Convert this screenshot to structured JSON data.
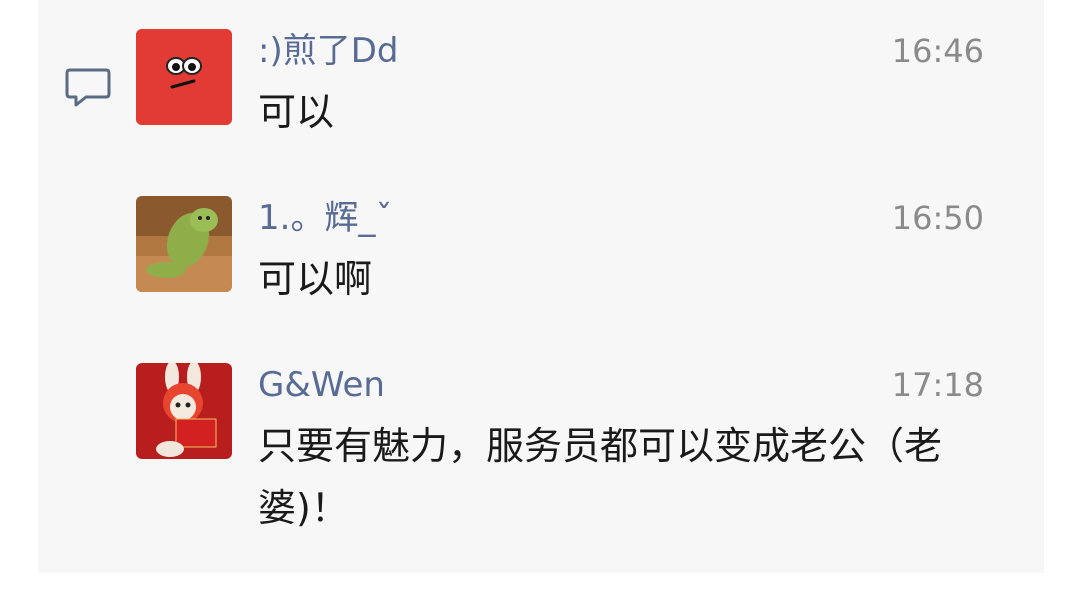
{
  "messages": [
    {
      "sender": ":)煎了Dd",
      "time": "16:46",
      "text": "可以",
      "avatar_icon": "red-square-face-avatar",
      "avatar_color": "#e23b35"
    },
    {
      "sender": "1.。辉_ˇ",
      "time": "16:50",
      "text": "可以啊",
      "avatar_icon": "green-plush-toy-avatar"
    },
    {
      "sender": "G&Wen",
      "time": "17:18",
      "text": "只要有魅力，服务员都可以变成老公（老婆)！",
      "avatar_icon": "rabbit-red-hood-avatar",
      "avatar_color": "#b81e1e"
    }
  ],
  "colors": {
    "sender_name": "#576b95",
    "time": "#8a8a8a",
    "panel_bg": "#f7f7f7"
  }
}
